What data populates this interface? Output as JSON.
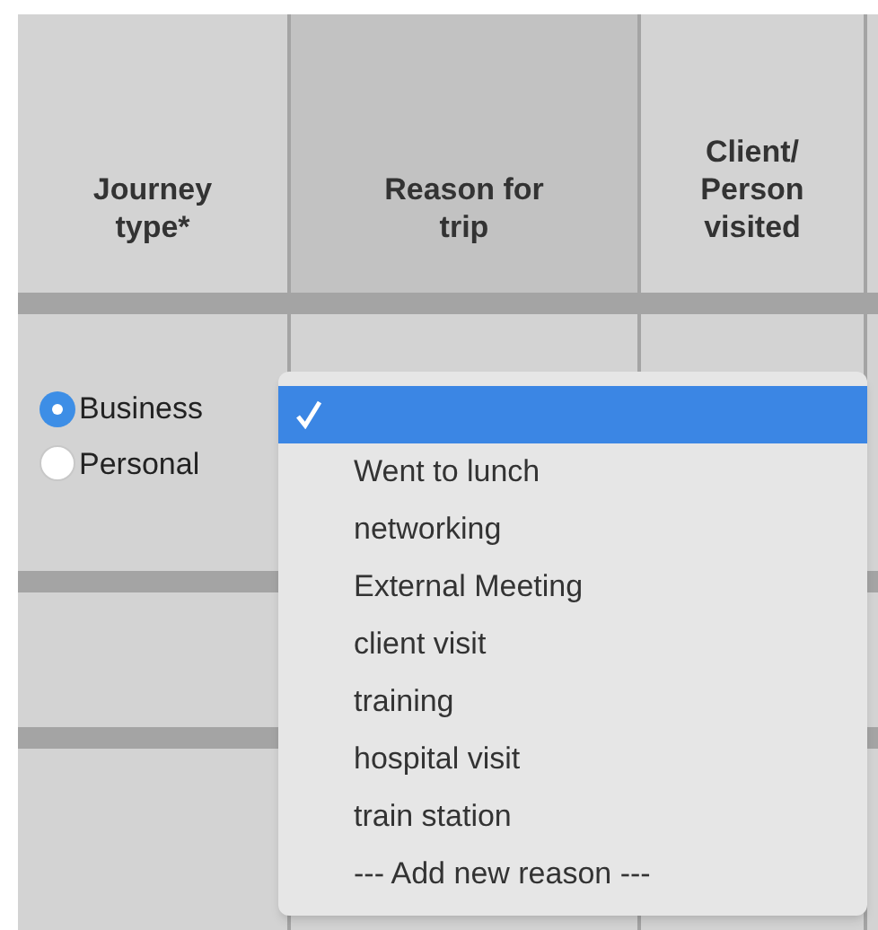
{
  "table": {
    "columns": [
      "Journey type*",
      "Reason for trip",
      "Client/ Person visited"
    ],
    "rows": [
      {
        "journey_type": [
          {
            "label": "Business",
            "selected": true
          },
          {
            "label": "Personal",
            "selected": false
          }
        ]
      }
    ]
  },
  "dropdown": {
    "items": [
      {
        "selected": true
      },
      {
        "label": "Went to lunch",
        "selected": false
      },
      {
        "label": "networking",
        "selected": false
      },
      {
        "label": "External Meeting",
        "selected": false
      },
      {
        "label": "client visit",
        "selected": false
      },
      {
        "label": "training",
        "selected": false
      },
      {
        "label": "hospital visit",
        "selected": false
      },
      {
        "label": "train station",
        "selected": false
      },
      {
        "label": "--- Add new reason ---",
        "selected": false
      }
    ]
  }
}
